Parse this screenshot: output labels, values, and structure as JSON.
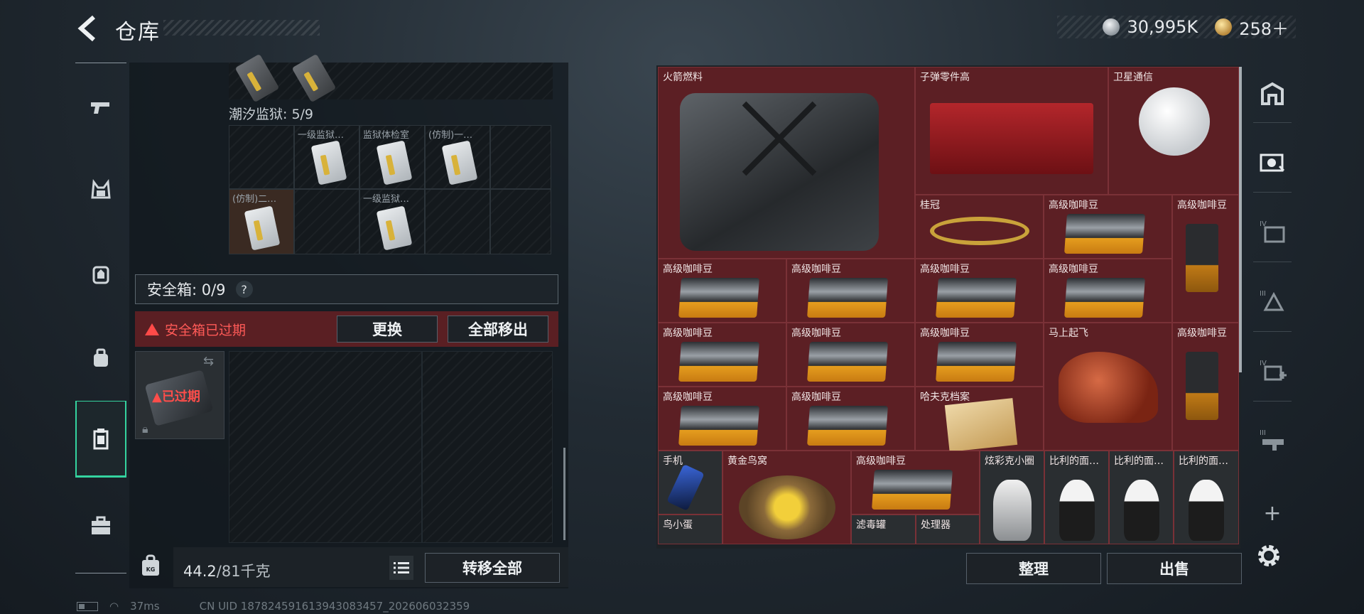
{
  "header": {
    "title": "仓库",
    "currency": [
      {
        "icon": "silver-coin-icon",
        "value": "30,995K"
      },
      {
        "icon": "gold-coin-icon",
        "value": "258＋"
      }
    ]
  },
  "left_rail": {
    "items": [
      {
        "name": "weapon",
        "icon": "pistol-icon"
      },
      {
        "name": "armor",
        "icon": "vest-icon"
      },
      {
        "name": "backpack",
        "icon": "backpack-icon"
      },
      {
        "name": "bag",
        "icon": "bag-icon"
      },
      {
        "name": "safe-case",
        "icon": "case-icon",
        "active": true
      },
      {
        "name": "briefcase",
        "icon": "briefcase-icon"
      }
    ]
  },
  "container": {
    "name": "潮汐监狱: 5/9",
    "cells": [
      {
        "label": "",
        "has_item": false
      },
      {
        "label": "一级监狱…",
        "has_item": true
      },
      {
        "label": "监狱体检室",
        "has_item": true
      },
      {
        "label": "(仿制)一…",
        "has_item": true
      },
      {
        "label": "",
        "has_item": false
      },
      {
        "label": "(仿制)二…",
        "has_item": true
      },
      {
        "label": "",
        "has_item": false
      },
      {
        "label": "一级监狱…",
        "has_item": true
      },
      {
        "label": "",
        "has_item": false
      },
      {
        "label": "",
        "has_item": false
      }
    ]
  },
  "safe_box": {
    "label": "安全箱: 0/9",
    "help": "?",
    "expired_notice": "安全箱已过期",
    "replace_button": "更换",
    "remove_all_button": "全部移出",
    "slot_status": "已过期"
  },
  "weight": {
    "current": "44.2",
    "limit": "/81千克",
    "transfer_all_button": "转移全部"
  },
  "status": {
    "ping": "37ms",
    "uid": "CN UID 18782459161394308345​7_202606032359"
  },
  "inventory": {
    "items": [
      {
        "label": "火箭燃料"
      },
      {
        "label": "子弹零件高"
      },
      {
        "label": "卫星通信"
      },
      {
        "label": "桂冠"
      },
      {
        "label": "高级咖啡豆"
      },
      {
        "label": "高级咖啡豆"
      },
      {
        "label": "高级咖啡豆"
      },
      {
        "label": "高级咖啡豆"
      },
      {
        "label": "高级咖啡豆"
      },
      {
        "label": "高级咖啡豆"
      },
      {
        "label": "高级咖啡豆"
      },
      {
        "label": "高级咖啡豆"
      },
      {
        "label": "高级咖啡豆"
      },
      {
        "label": "马上起飞"
      },
      {
        "label": "高级咖啡豆"
      },
      {
        "label": "高级咖啡豆"
      },
      {
        "label": "高级咖啡豆"
      },
      {
        "label": "哈夫克档案"
      },
      {
        "label": "手机"
      },
      {
        "label": "黄金鸟窝"
      },
      {
        "label": "高级咖啡豆"
      },
      {
        "label": "炫彩克小圈"
      },
      {
        "label": "比利的面…"
      },
      {
        "label": "比利的面…"
      },
      {
        "label": "比利的面…"
      },
      {
        "label": "鸟小蛋"
      },
      {
        "label": "滤毒罐"
      },
      {
        "label": "处理器"
      }
    ],
    "sort_button": "整理",
    "sell_button": "出售"
  },
  "right_rail": {
    "items": [
      {
        "name": "stash-home",
        "icon": "stash-icon"
      },
      {
        "name": "stash-filter",
        "icon": "filter-icon"
      },
      {
        "name": "stash-iv-folder",
        "icon": "folder-iv-icon"
      },
      {
        "name": "stash-iii-warning",
        "icon": "warning-iii-icon"
      },
      {
        "name": "stash-iv-add",
        "icon": "add-iv-icon"
      },
      {
        "name": "stash-iii-gun",
        "icon": "gun-iii-icon"
      }
    ],
    "add_label": "+"
  }
}
